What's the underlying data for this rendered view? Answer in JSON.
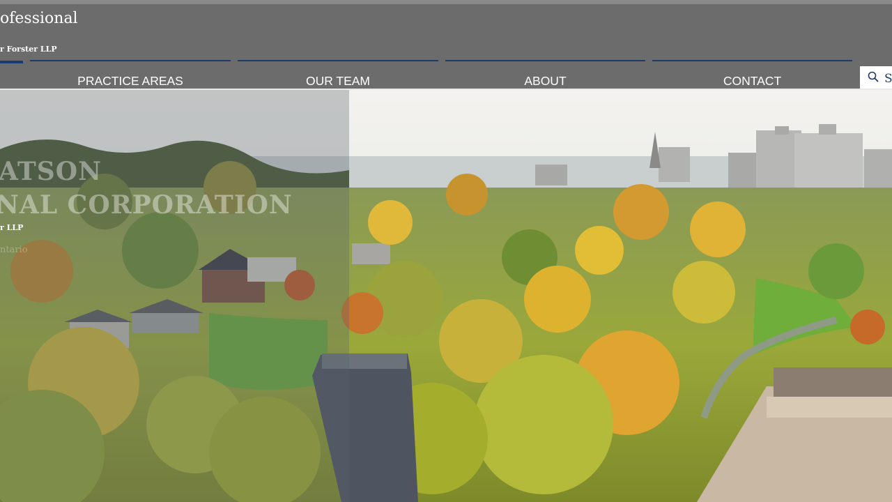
{
  "header": {
    "title_fragment": "ofessional",
    "subtitle_fragment": "r Forster LLP",
    "nav": [
      {
        "label": "PRACTICE AREAS"
      },
      {
        "label": "OUR TEAM"
      },
      {
        "label": "ABOUT"
      },
      {
        "label": "CONTACT"
      }
    ],
    "search": {
      "placeholder": "S",
      "icon": "search-icon"
    }
  },
  "hero": {
    "overlay_lines": [
      "ATSON",
      "NAL CORPORATION",
      "r LLP",
      "ntario"
    ]
  },
  "colors": {
    "header_bg": "#6c6c6c",
    "nav_text": "#ffffff",
    "accent_navy": "#1e3a66",
    "search_bg": "#ffffff"
  }
}
